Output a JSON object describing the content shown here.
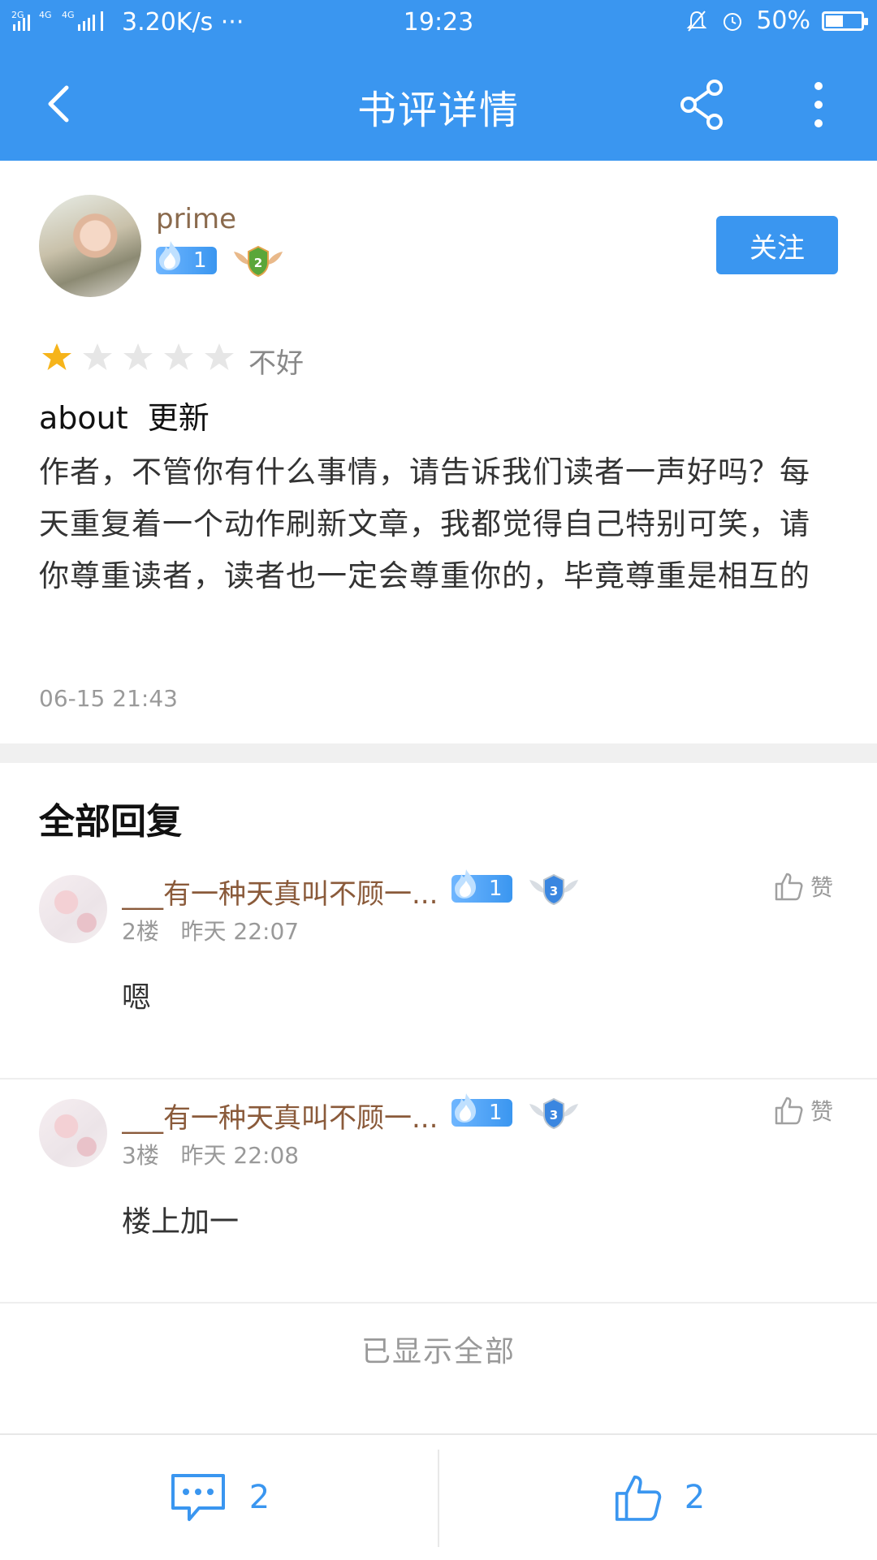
{
  "status_bar": {
    "signal_text": "2G 4G 4G",
    "net_speed": "3.20K/s ···",
    "time": "19:23",
    "battery": "50%",
    "battery_level": 0.5
  },
  "app_bar": {
    "title": "书评详情",
    "back_icon": "back-arrow",
    "share_icon": "share",
    "more_icon": "more-vertical"
  },
  "review": {
    "author": "prime",
    "level": "1",
    "medal": "2",
    "follow_label": "关注",
    "stars_filled": 1,
    "stars_total": 5,
    "rating_text": "不好",
    "title": "about  更新",
    "body": "作者，不管你有什么事情，请告诉我们读者一声好吗？每天重复着一个动作刷新文章，我都觉得自己特别可笑，请你尊重读者，读者也一定会尊重你的，毕竟尊重是相互的",
    "time": "06-15 21:43"
  },
  "replies": {
    "title": "全部回复",
    "items": [
      {
        "name": "___有一种天真叫不顾一...",
        "level": "1",
        "medal": "3",
        "meta": "2楼   昨天 22:07",
        "like_label": "赞",
        "content": "嗯"
      },
      {
        "name": "___有一种天真叫不顾一...",
        "level": "1",
        "medal": "3",
        "meta": "3楼   昨天 22:08",
        "like_label": "赞",
        "content": "楼上加一"
      }
    ],
    "all_shown": "已显示全部"
  },
  "bottom_bar": {
    "comment_count": "2",
    "like_count": "2"
  },
  "colors": {
    "primary": "#3a96f0",
    "star_filled": "#f6b41a",
    "star_empty": "#e6e6e6",
    "username": "#8a6a4d"
  }
}
